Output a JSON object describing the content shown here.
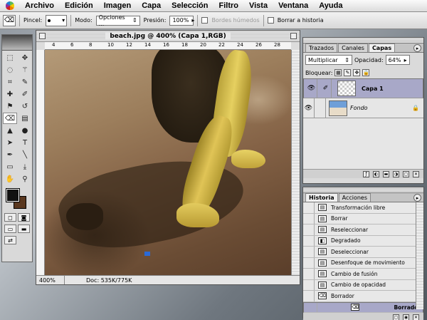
{
  "menubar": {
    "items": [
      "Archivo",
      "Edición",
      "Imagen",
      "Capa",
      "Selección",
      "Filtro",
      "Vista",
      "Ventana",
      "Ayuda"
    ]
  },
  "options_bar": {
    "brush_label": "Pincel:",
    "mode_label": "Modo:",
    "mode_value": "Opciones ...",
    "pressure_label": "Presión:",
    "pressure_value": "100%",
    "wet_edges_label": "Bordes húmedos",
    "erase_history_label": "Borrar a historia"
  },
  "document": {
    "title": "beach.jpg @ 400% (Capa 1,RGB)",
    "zoom": "400%",
    "doc_info": "Doc: 535K/775K",
    "ruler_marks": [
      "4",
      "6",
      "8",
      "10",
      "12",
      "14",
      "16",
      "18",
      "20",
      "22",
      "24",
      "26",
      "28"
    ]
  },
  "layers_palette": {
    "tabs": [
      "Trazados",
      "Canales",
      "Capas"
    ],
    "blend_mode": "Multiplicar",
    "opacity_label": "Opacidad:",
    "opacity_value": "64%",
    "lock_label": "Bloquear:",
    "layers": [
      {
        "name": "Capa 1",
        "selected": true
      },
      {
        "name": "Fondo",
        "selected": false
      }
    ]
  },
  "history_palette": {
    "tabs": [
      "Historia",
      "Acciones"
    ],
    "items": [
      "Transformación libre",
      "Borrar",
      "Reseleccionar",
      "Degradado",
      "Deseleccionar",
      "Desenfoque de movimiento",
      "Cambio de fusión",
      "Cambio de opacidad",
      "Borrador",
      "Borrador"
    ]
  },
  "colors": {
    "foreground": "#111111",
    "background": "#5a3820",
    "selection": "#a8a8c8"
  }
}
